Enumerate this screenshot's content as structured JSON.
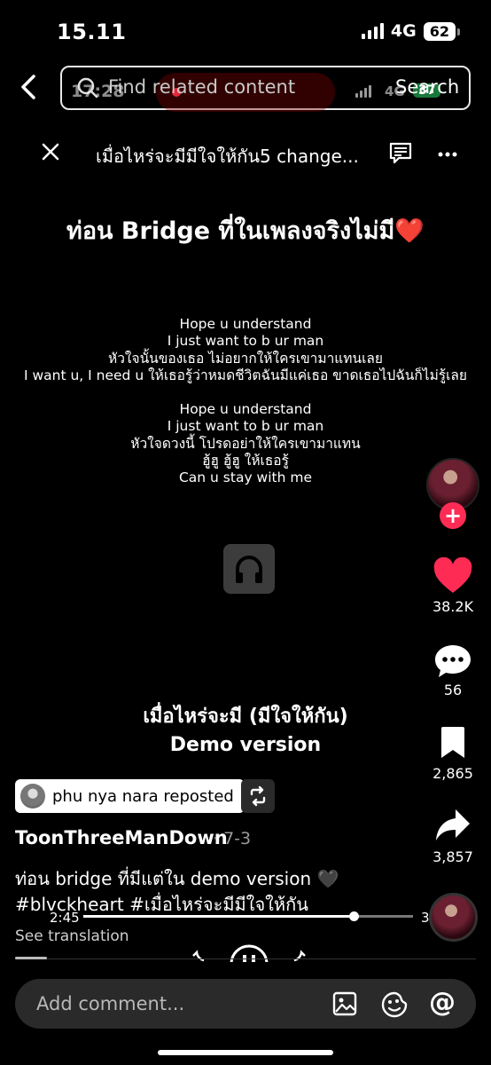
{
  "status_bar": {
    "time": "15.11",
    "network": "4G",
    "battery": "62"
  },
  "ghost_status": {
    "time": "17:28",
    "network": "4G",
    "battery": "37"
  },
  "search": {
    "placeholder": "Find related content",
    "button": "Search"
  },
  "header": {
    "title": "เมื่อไหร่จะมีมีใจให้กัน5 change..."
  },
  "video": {
    "headline": "ท่อน Bridge ที่ในเพลงจริงไม่มี❤️",
    "lyrics": [
      "Hope u understand",
      "I just want to b ur man",
      "หัวใจนั้นของเธอ ไม่อยากให้ใครเขามาแทนเลย",
      "I want u, I need u ให้เธอรู้ว่าหมดชีวิตฉันมีแค่เธอ ขาดเธอไปฉันก็ไม่รู้เลย",
      "",
      "Hope u understand",
      "I just want to b ur man",
      "หัวใจดวงนี้ โปรดอย่าให้ใครเขามาแทน",
      "ฮู้ฮู ฮู้ฮู ให้เธอรู้",
      "Can u stay with me"
    ],
    "song_title_line1": "เมื่อไหร่จะมี (มีใจให้กัน)",
    "song_title_line2": "Demo version"
  },
  "actions": {
    "likes": "38.2K",
    "comments": "56",
    "saves": "2,865",
    "shares": "3,857"
  },
  "repost": {
    "text": "phu nya nara reposted"
  },
  "post": {
    "username": "ToonThreeManDown",
    "date": "· 7-3",
    "caption_line1": "ท่อน bridge ที่มีแต่ใน demo version 🖤",
    "caption_line2": "#blvckheart #เมื่อไหร่จะมีมีใจให้กัน",
    "see_translation": "See translation"
  },
  "player": {
    "current_time": "2:45",
    "total_time": "3",
    "progress": 0.82
  },
  "comment": {
    "placeholder": "Add comment..."
  },
  "colors": {
    "like": "#fe2c55",
    "accent": "#fe2c55",
    "background": "#000000"
  }
}
